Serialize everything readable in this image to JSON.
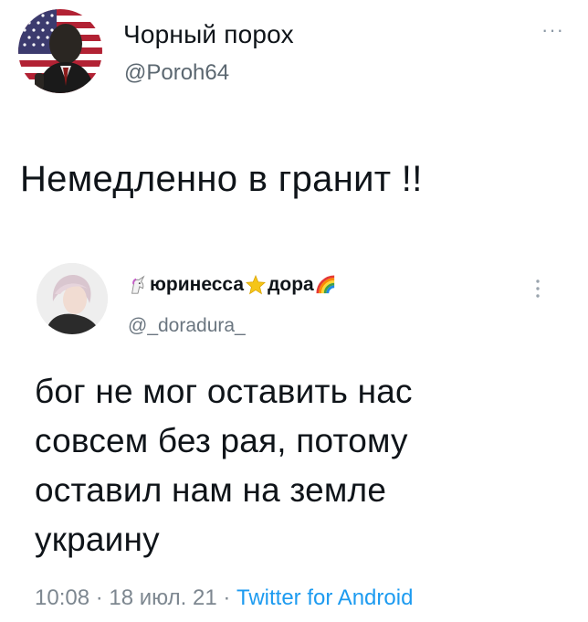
{
  "main_tweet": {
    "author_name": "Чорный порох",
    "handle": "@Poroh64",
    "more_label": "···",
    "text": "Немедленно в гранит !!"
  },
  "quoted_tweet": {
    "name_part1": "юринесса",
    "name_part2": "дора",
    "handle": "@_doradura_",
    "more_label": "⋮",
    "text": "бог не мог оставить нас\nсовсем без рая, потому\nоставил нам на земле\nукраину",
    "time": "10:08",
    "separator": " · ",
    "date": "18 июл. 21",
    "source": "Twitter for Android"
  },
  "icons": {
    "main_avatar": "american-flag-portrait-avatar",
    "quoted_avatar": "person-portrait-avatar",
    "name_emoji_1": "unicorn-icon",
    "name_emoji_2": "star-icon",
    "name_emoji_3": "rainbow-icon"
  },
  "colors": {
    "text_primary": "#0f1419",
    "text_secondary": "#5b6770",
    "link": "#1d9bf0"
  }
}
